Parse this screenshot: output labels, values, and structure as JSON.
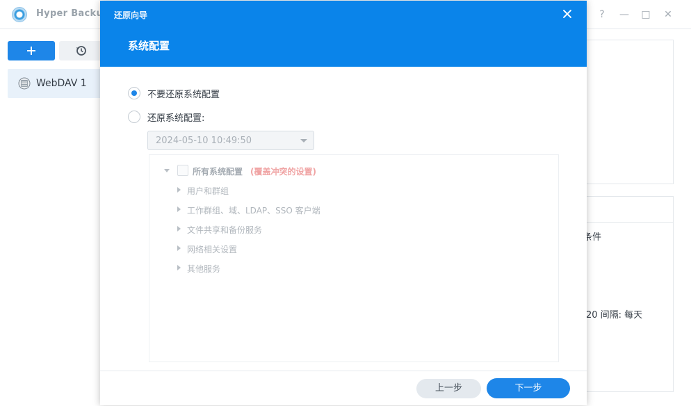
{
  "app": {
    "title": "Hyper Backup",
    "window_controls": {
      "help": "?",
      "minimize": "—",
      "maximize": "□",
      "close": "✕"
    }
  },
  "sidebar": {
    "add_icon": "plus-icon",
    "history_icon": "history-icon",
    "tasks": [
      {
        "label": "WebDAV 1",
        "icon": "server-icon"
      }
    ]
  },
  "background_panel": {
    "text_line1": "条件",
    "text_line2": "20 间隔: 每天"
  },
  "dialog": {
    "caption": "还原向导",
    "heading": "系统配置",
    "options": [
      {
        "label": "不要还原系统配置",
        "selected": true
      },
      {
        "label": "还原系统配置:",
        "selected": false
      }
    ],
    "version_select": {
      "value": "2024-05-10 10:49:50"
    },
    "tree": {
      "root_label": "所有系统配置",
      "root_warning": "(覆盖冲突的设置)",
      "children": [
        "用户和群组",
        "工作群组、域、LDAP、SSO 客户端",
        "文件共享和备份服务",
        "网络相关设置",
        "其他服务"
      ]
    },
    "buttons": {
      "prev": "上一步",
      "next": "下一步"
    }
  },
  "colors": {
    "accent": "#1e86e8",
    "header": "#0a84ea",
    "warning_text": "#f0a4a4"
  }
}
